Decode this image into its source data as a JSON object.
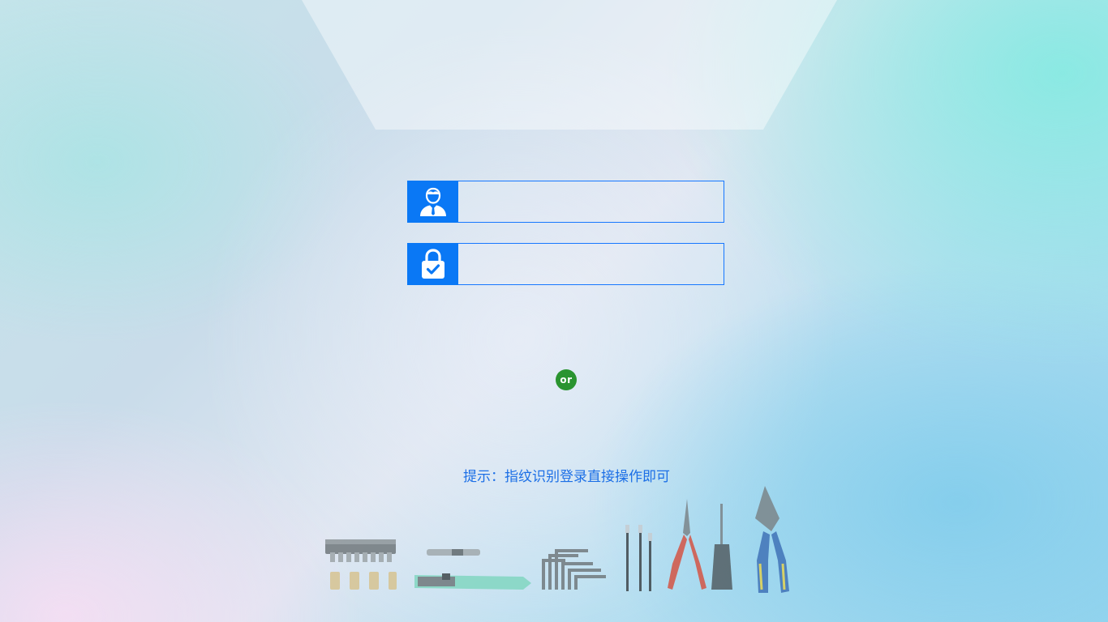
{
  "login": {
    "username": {
      "value": "",
      "placeholder": ""
    },
    "password": {
      "value": "",
      "placeholder": ""
    }
  },
  "divider": {
    "label": "or"
  },
  "hint": {
    "text": "提示：指纹识别登录直接操作即可"
  },
  "icons": {
    "username": "user-icon",
    "password": "lock-check-icon",
    "banner": "tools-illustration"
  },
  "colors": {
    "accent": "#0a78f5",
    "border": "#1677ff",
    "or_badge": "#2a9430",
    "hint_text": "#1c6fe6"
  }
}
